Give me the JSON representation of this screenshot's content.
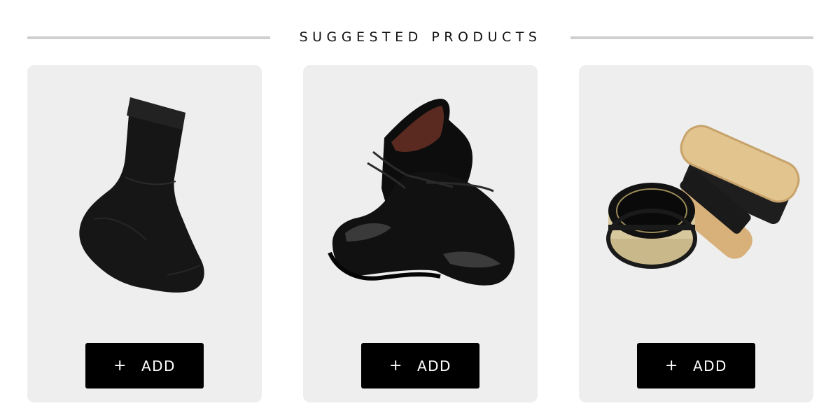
{
  "section": {
    "title": "SUGGESTED PRODUCTS"
  },
  "products": [
    {
      "icon": "sock-icon",
      "button_icon": "+",
      "button_label": "ADD"
    },
    {
      "icon": "dress-shoes-icon",
      "button_icon": "+",
      "button_label": "ADD"
    },
    {
      "icon": "shoe-polish-kit-icon",
      "button_icon": "+",
      "button_label": "ADD"
    }
  ],
  "colors": {
    "card_background": "#eeeeee",
    "button_background": "#000000",
    "button_text": "#ffffff",
    "divider": "#cfcfcf",
    "title_text": "#111111"
  }
}
